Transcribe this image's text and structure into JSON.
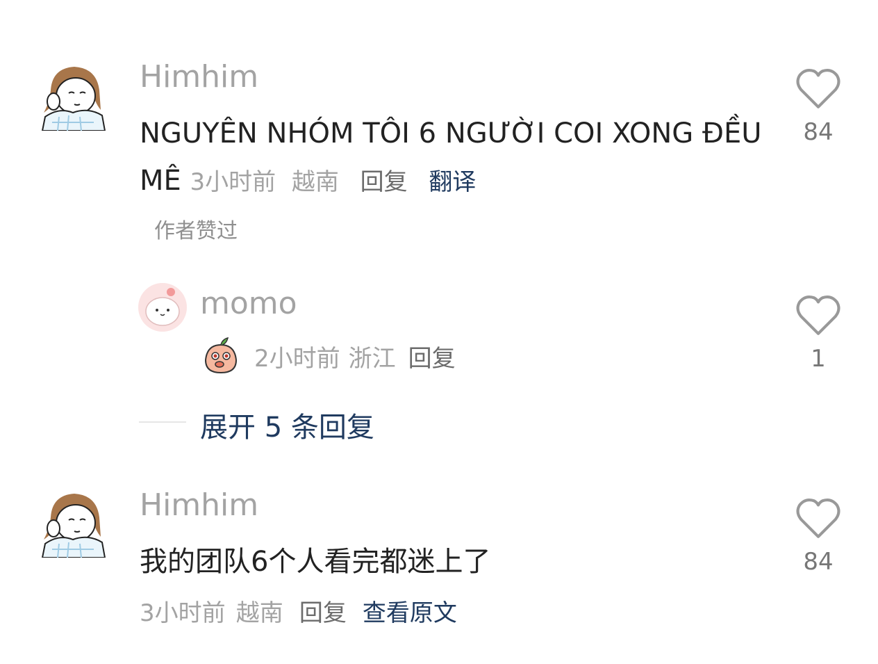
{
  "comments": [
    {
      "user": "Himhim",
      "text": "NGUYÊN NHÓM TÔI 6 NGƯỜI COI XONG ĐỀU MÊ",
      "time": "3小时前",
      "location": "越南",
      "reply_label": "回复",
      "action_label": "翻译",
      "author_liked": "作者赞过",
      "likes": "84"
    },
    {
      "user": "Himhim",
      "text": "我的团队6个人看完都迷上了",
      "time": "3小时前",
      "location": "越南",
      "reply_label": "回复",
      "action_label": "查看原文",
      "likes": "84"
    }
  ],
  "reply": {
    "user": "momo",
    "time": "2小时前",
    "location": "浙江",
    "reply_label": "回复",
    "likes": "1",
    "emoji": "peach-sticker-icon"
  },
  "expand_label": "展开 5 条回复",
  "colors": {
    "link": "#1f3a5f",
    "meta": "#a3a3a3",
    "text": "#222222"
  }
}
